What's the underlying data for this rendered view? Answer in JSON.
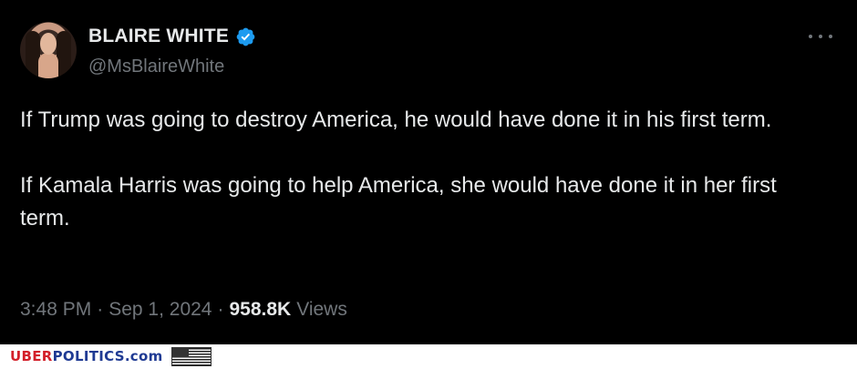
{
  "tweet": {
    "display_name": "BLAIRE WHITE",
    "handle": "@MsBlaireWhite",
    "verified": true,
    "text_paragraphs": [
      "If Trump was going to destroy America, he would have done it in his first term.",
      "If Kamala Harris was going to help America, she would have done it in her first term."
    ],
    "time": "3:48 PM",
    "separator": "·",
    "date": "Sep 1, 2024",
    "views_count": "958.8K",
    "views_label": "Views"
  },
  "watermark": {
    "uber": "UBER",
    "politics": "POLITICS",
    "com": ".com"
  },
  "colors": {
    "background": "#000000",
    "text": "#e7e9ea",
    "muted": "#71767b",
    "verified": "#1d9bf0",
    "brand_red": "#d3202a",
    "brand_blue": "#1f3a93"
  },
  "icons": [
    "avatar",
    "verified-badge-icon",
    "more-options-icon",
    "us-flag-icon"
  ]
}
